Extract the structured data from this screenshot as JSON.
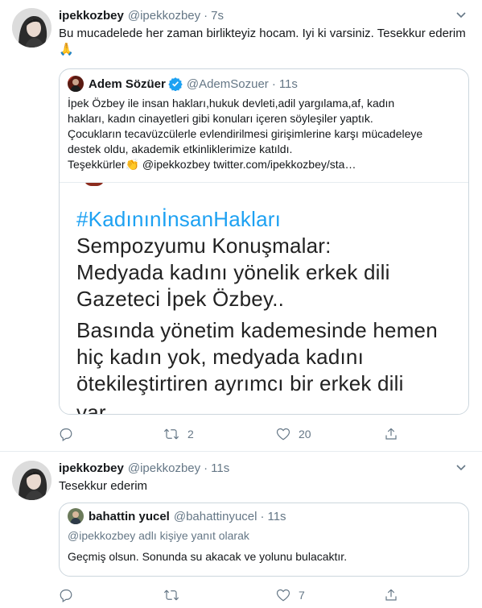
{
  "colors": {
    "accent": "#1da1f2",
    "secondary_text": "#657786",
    "primary_text": "#14171a",
    "border": "#ccd6dd"
  },
  "tweets": [
    {
      "author_name": "ipekkozbey",
      "author_handle": "@ipekkozbey",
      "separator": "·",
      "time": "7s",
      "text": "Bu mucadelede her zaman birlikteyiz hocam. Iyi ki varsiniz. Tesekkur ederim🙏",
      "quote": {
        "author_name": "Adem Sözüer",
        "verified_icon": "verified-badge-icon",
        "author_handle": "@AdemSozuer",
        "separator": "·",
        "time": "11s",
        "text_lines": [
          "İpek Özbey ile insan hakları,hukuk devleti,adil yargılama,af, kadın",
          "hakları, kadın cinayetleri gibi konuları içeren söyleşiler yaptık.",
          "Çocukların tecavüzcülerle evlendirilmesi girişimlerine karşı mücadeleye",
          "destek oldu, akademik etkinliklerimize katıldı.",
          "Teşekkürler👏 @ipekkozbey  twitter.com/ipekkozbey/sta…"
        ],
        "media_text": {
          "hashtag": "#KadınınİnsanHakları",
          "lines": [
            "Sempozyumu Konuşmalar:",
            "Medyada kadını yönelik erkek dili",
            "Gazeteci İpek Özbey..",
            "Basında yönetim kademesinde hemen",
            "hiç kadın yok, medyada kadını",
            "ötekileştirtiren ayrımcı bir erkek dili",
            "var"
          ]
        }
      },
      "actions": {
        "reply_count": "",
        "retweet_count": "2",
        "like_count": "20"
      }
    },
    {
      "author_name": "ipekkozbey",
      "author_handle": "@ipekkozbey",
      "separator": "·",
      "time": "11s",
      "text": "Tesekkur ederim",
      "quote": {
        "author_name": "bahattin yucel",
        "author_handle": "@bahattinyucel",
        "separator": "·",
        "time": "11s",
        "replying_to": "@ipekkozbey adlı kişiye yanıt olarak",
        "text": "Geçmiş olsun. Sonunda su akacak ve yolunu bulacaktır."
      },
      "actions": {
        "reply_count": "",
        "retweet_count": "",
        "like_count": "7"
      }
    }
  ]
}
